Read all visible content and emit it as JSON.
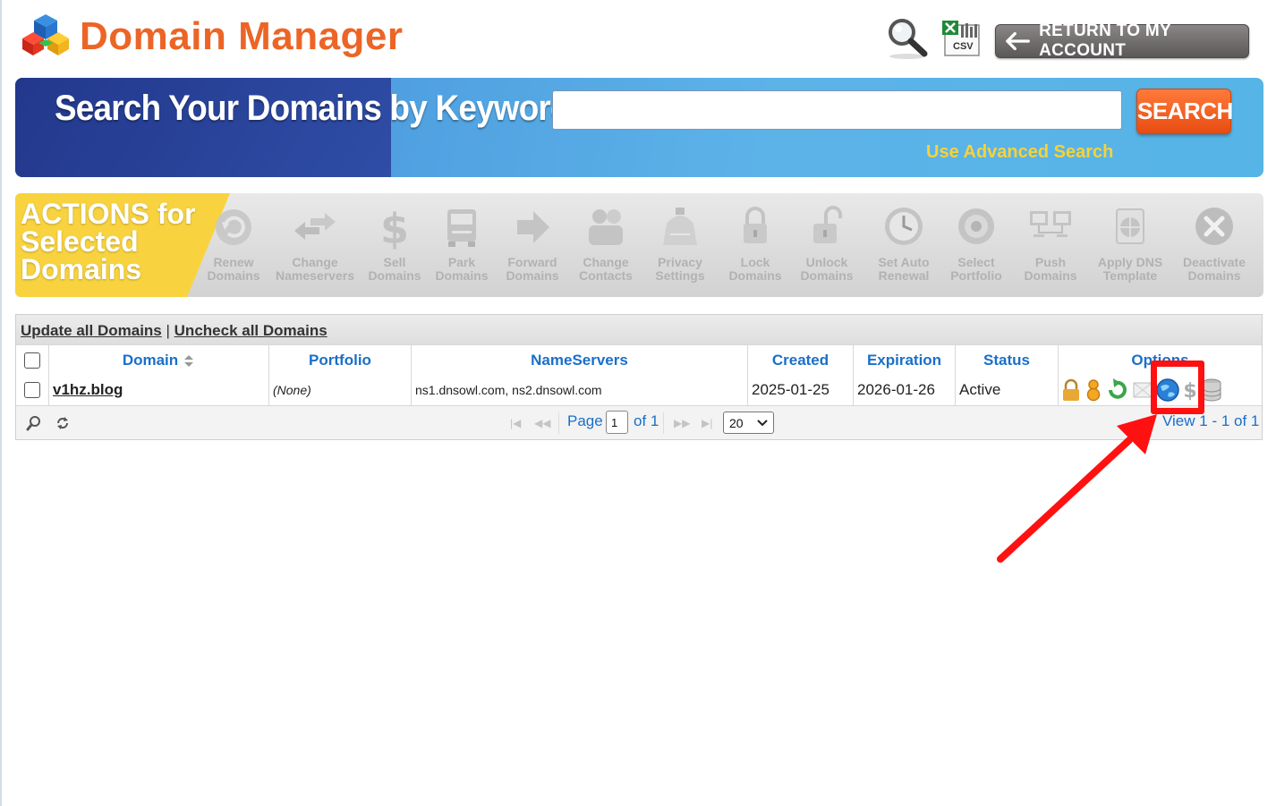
{
  "header": {
    "title": "Domain Manager",
    "csv_label": "CSV",
    "return_button": "RETURN TO MY ACCOUNT"
  },
  "search": {
    "heading": "Search Your Domains by Keyword",
    "input_value": "",
    "button": "SEARCH",
    "advanced_link": "Use Advanced Search"
  },
  "actions": {
    "title_lines": [
      "ACTIONS for",
      "Selected",
      "Domains"
    ],
    "items": [
      {
        "line1": "Renew",
        "line2": "Domains",
        "icon": "renew-icon"
      },
      {
        "line1": "Change",
        "line2": "Nameservers",
        "icon": "change-nameservers-icon"
      },
      {
        "line1": "Sell",
        "line2": "Domains",
        "icon": "dollar-icon"
      },
      {
        "line1": "Park",
        "line2": "Domains",
        "icon": "truck-icon"
      },
      {
        "line1": "Forward",
        "line2": "Domains",
        "icon": "forward-arrow-icon"
      },
      {
        "line1": "Change",
        "line2": "Contacts",
        "icon": "contacts-icon"
      },
      {
        "line1": "Privacy",
        "line2": "Settings",
        "icon": "privacy-bag-icon"
      },
      {
        "line1": "Lock",
        "line2": "Domains",
        "icon": "lock-icon"
      },
      {
        "line1": "Unlock",
        "line2": "Domains",
        "icon": "unlock-icon"
      },
      {
        "line1": "Set Auto",
        "line2": "Renewal",
        "icon": "clock-icon"
      },
      {
        "line1": "Select",
        "line2": "Portfolio",
        "icon": "portfolio-icon"
      },
      {
        "line1": "Push",
        "line2": "Domains",
        "icon": "push-monitors-icon"
      },
      {
        "line1": "Apply DNS",
        "line2": "Template",
        "icon": "dns-template-icon"
      },
      {
        "line1": "Deactivate",
        "line2": "Domains",
        "icon": "deactivate-x-icon"
      }
    ]
  },
  "table": {
    "update_all": "Update all Domains",
    "separator": "|",
    "uncheck_all": "Uncheck all Domains",
    "columns": [
      "Domain",
      "Portfolio",
      "NameServers",
      "Created",
      "Expiration",
      "Status",
      "Options"
    ],
    "rows": [
      {
        "domain": "v1hz.blog",
        "portfolio": "(None)",
        "nameservers": "ns1.dnsowl.com, ns2.dnsowl.com",
        "created": "2025-01-25",
        "expiration": "2026-01-26",
        "status": "Active",
        "options": [
          "lock-icon",
          "privacy-icon",
          "renew-arrow-icon",
          "email-forward-icon",
          "dns-globe-icon",
          "sell-dollar-icon",
          "database-icon"
        ]
      }
    ]
  },
  "pager": {
    "page_label": "Page",
    "page_value": "1",
    "of_label": "of 1",
    "page_size": "20",
    "view_text": "View 1 - 1 of 1"
  },
  "annotation": {
    "highlight_color": "#ff1111",
    "target": "dns-globe-icon"
  }
}
